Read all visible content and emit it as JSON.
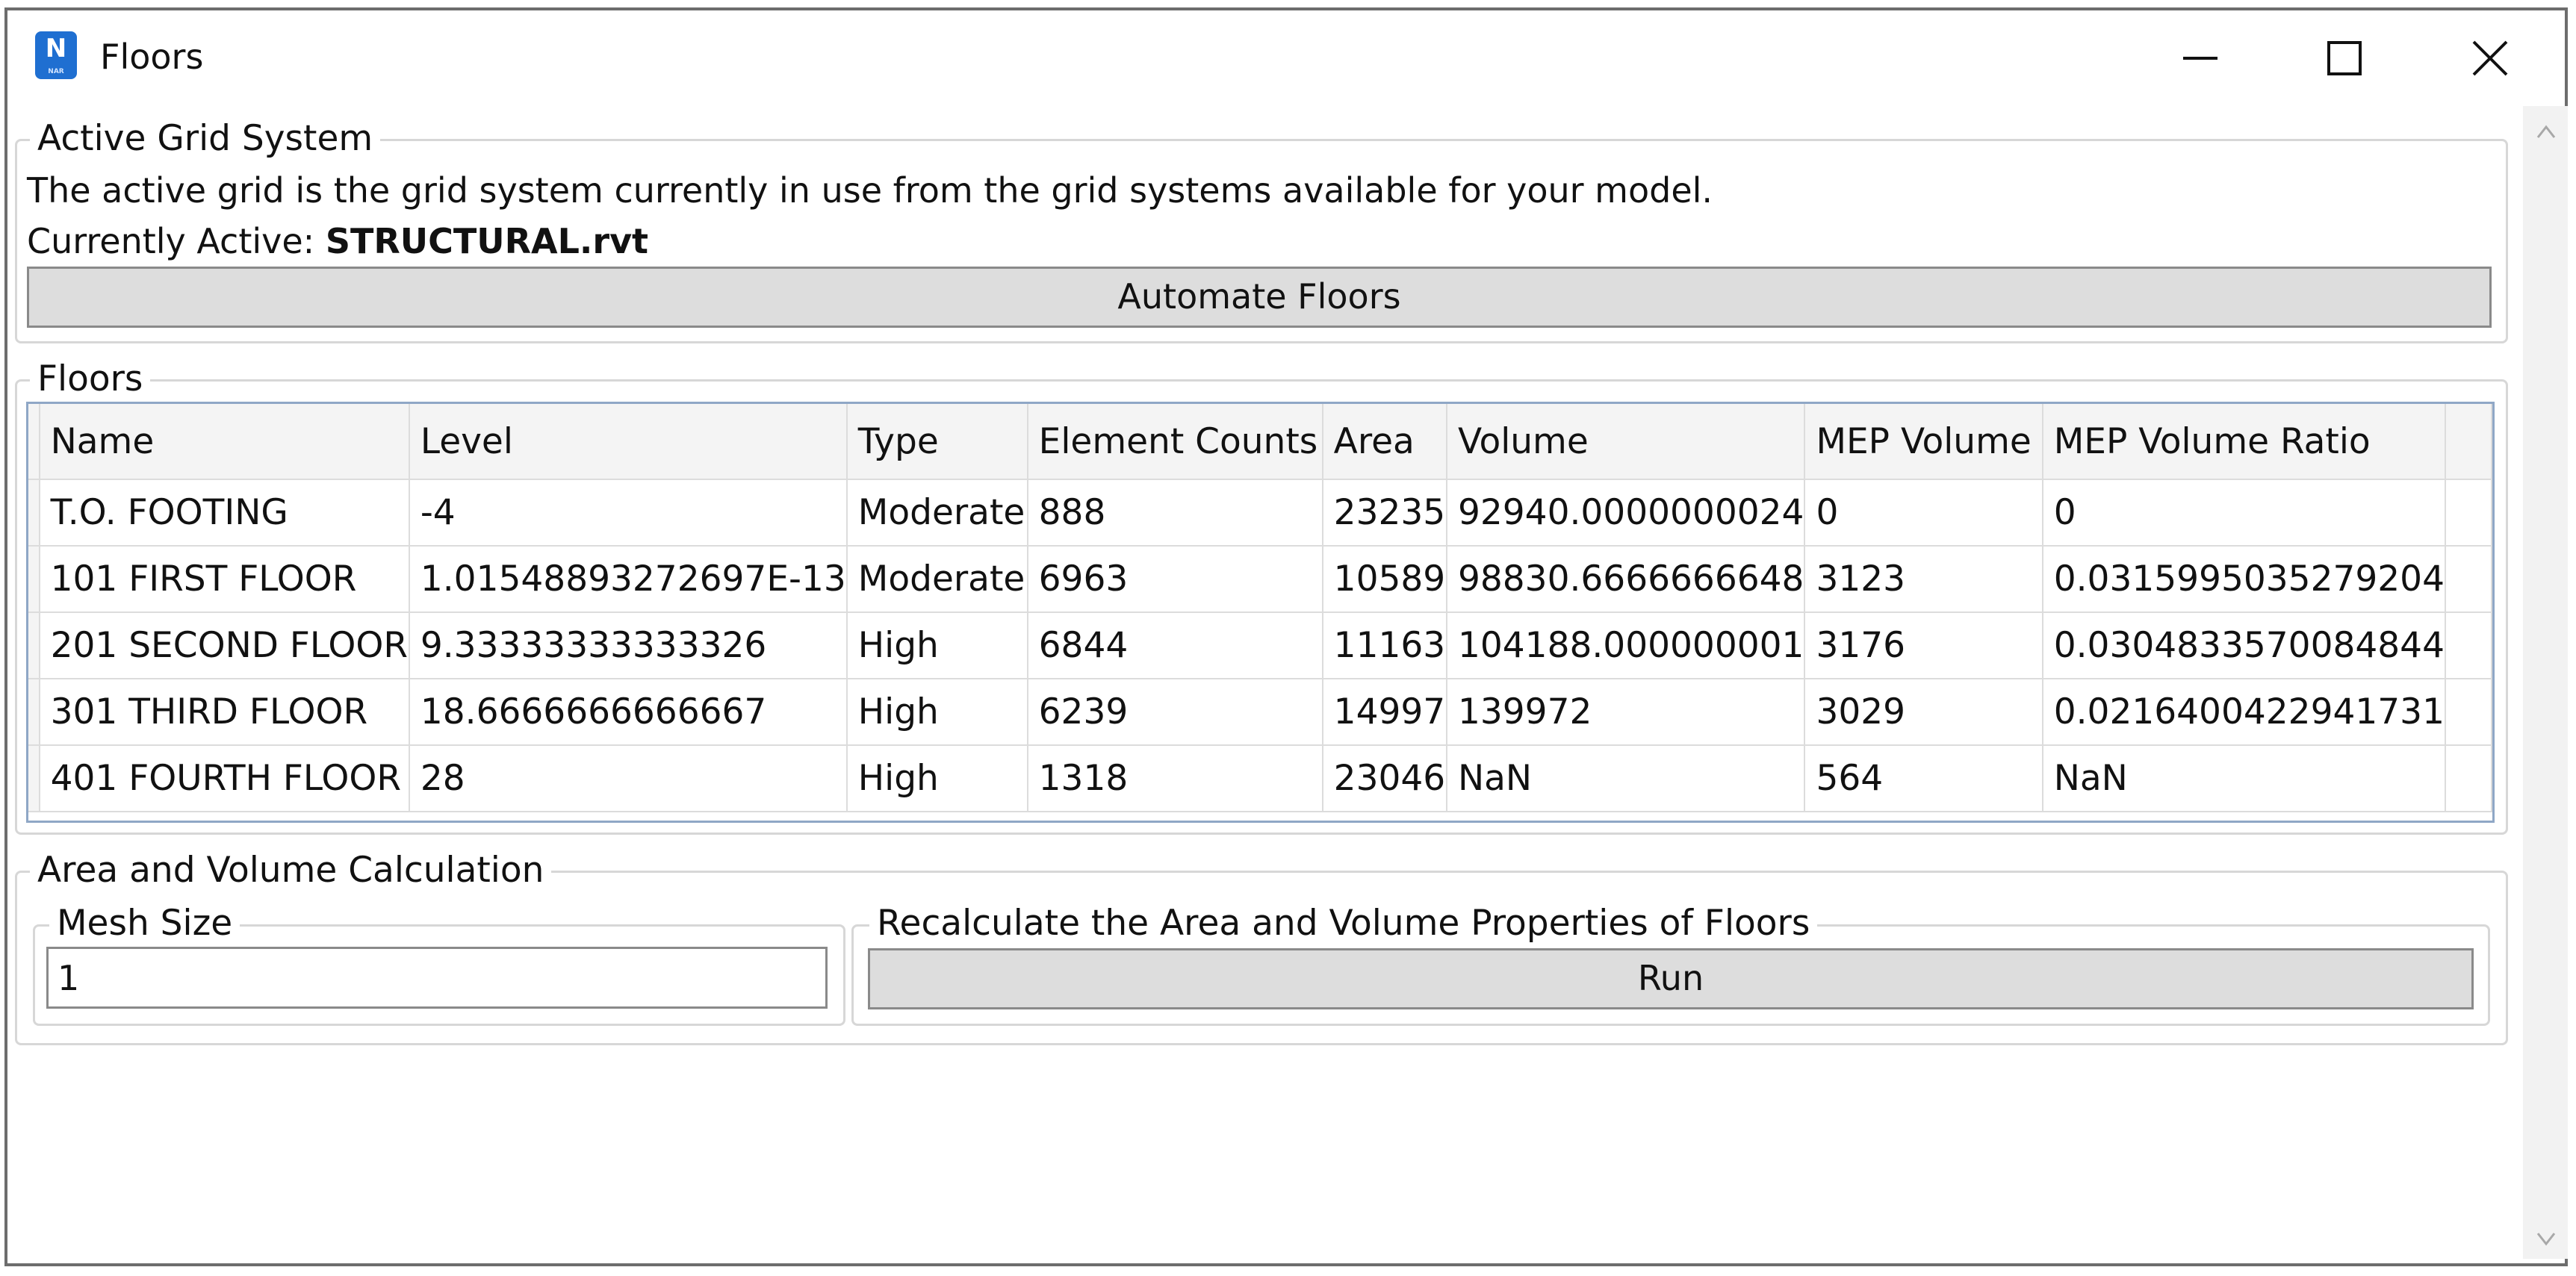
{
  "window": {
    "title": "Floors",
    "icon_letter": "N",
    "icon_sub": "NAR",
    "controls": [
      "minimize-icon",
      "maximize-icon",
      "close-icon"
    ]
  },
  "active_grid": {
    "group_label": "Active Grid System",
    "description": "The active grid is the grid system currently in use from the grid systems available for your model.",
    "current_label": "Currently Active: ",
    "current_value": "STRUCTURAL.rvt",
    "button_label": "Automate Floors"
  },
  "floors": {
    "group_label": "Floors",
    "columns": [
      "Name",
      "Level",
      "Type",
      "Element Counts",
      "Area",
      "Volume",
      "MEP Volume",
      "MEP Volume Ratio"
    ],
    "rows": [
      [
        "T.O. FOOTING",
        "-4",
        "Moderate",
        "888",
        "23235",
        "92940.0000000024",
        "0",
        "0"
      ],
      [
        "101 FIRST FLOOR",
        "1.01548893272697E-13",
        "Moderate",
        "6963",
        "10589",
        "98830.6666666648",
        "3123",
        "0.0315995035279204"
      ],
      [
        "201 SECOND FLOOR",
        "9.33333333333326",
        "High",
        "6844",
        "11163",
        "104188.000000001",
        "3176",
        "0.0304833570084844"
      ],
      [
        "301 THIRD FLOOR",
        "18.6666666666667",
        "High",
        "6239",
        "14997",
        "139972",
        "3029",
        "0.0216400422941731"
      ],
      [
        "401 FOURTH FLOOR",
        "28",
        "High",
        "1318",
        "23046",
        "NaN",
        "564",
        "NaN"
      ]
    ]
  },
  "calc": {
    "group_label": "Area and Volume Calculation",
    "mesh_label": "Mesh Size",
    "mesh_value": "1",
    "recalc_label": "Recalculate the Area and Volume Properties of Floors",
    "run_label": "Run"
  }
}
